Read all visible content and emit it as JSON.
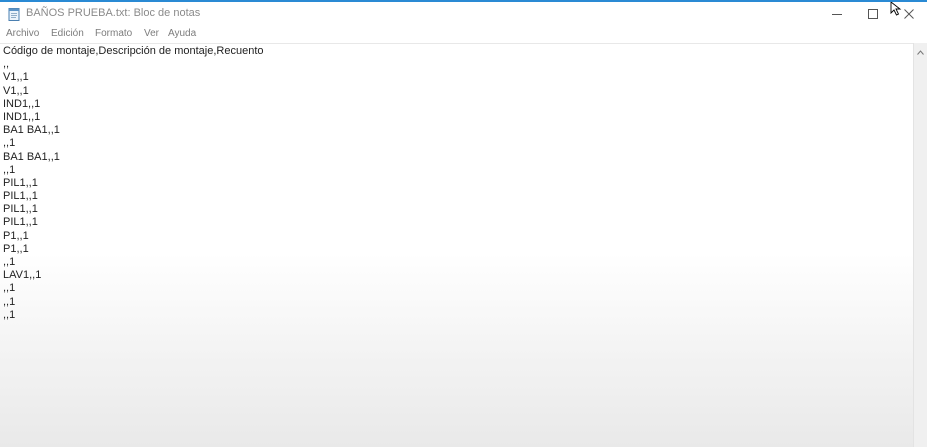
{
  "window": {
    "title": "BAÑOS PRUEBA.txt: Bloc de notas"
  },
  "menu": {
    "items": [
      {
        "label": "Archivo"
      },
      {
        "label": "Edición"
      },
      {
        "label": "Formato"
      },
      {
        "label": "Ver"
      },
      {
        "label": "Ayuda"
      }
    ]
  },
  "editor": {
    "lines": [
      "Código de montaje,Descripción de montaje,Recuento",
      ",,",
      "V1,,1",
      "V1,,1",
      "IND1,,1",
      "IND1,,1",
      "BA1 BA1,,1",
      ",,1",
      "BA1 BA1,,1",
      ",,1",
      "PIL1,,1",
      "PIL1,,1",
      "PIL1,,1",
      "PIL1,,1",
      "P1,,1",
      "P1,,1",
      ",,1",
      "LAV1,,1",
      ",,1",
      ",,1",
      ",,1"
    ]
  },
  "colors": {
    "accent": "#2a8ad4",
    "menu_text": "#7c7c7c",
    "editor_text": "#222222"
  }
}
